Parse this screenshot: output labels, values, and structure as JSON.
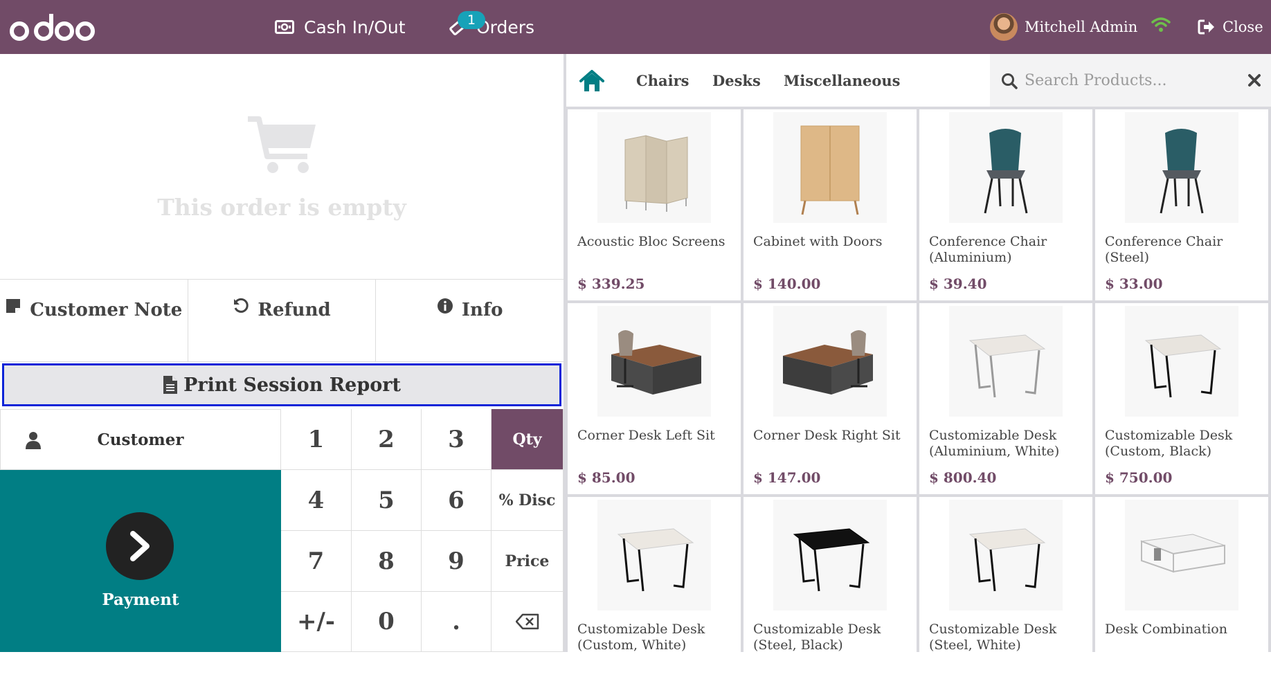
{
  "header": {
    "cash_label": "Cash In/Out",
    "orders_label": "Orders",
    "orders_badge": "1",
    "user_name": "Mitchell Admin",
    "close_label": "Close",
    "bg_color": "#714B67"
  },
  "order": {
    "empty_text": "This order is empty"
  },
  "controls": {
    "customer_note": "Customer Note",
    "refund": "Refund",
    "info": "Info",
    "print_session_report": "Print Session Report",
    "customer": "Customer",
    "payment": "Payment"
  },
  "numpad": {
    "keys": [
      "1",
      "2",
      "3",
      "Qty",
      "4",
      "5",
      "6",
      "% Disc",
      "7",
      "8",
      "9",
      "Price",
      "+/-",
      "0",
      "."
    ],
    "active_mode": "Qty"
  },
  "categories": {
    "items": [
      "Chairs",
      "Desks",
      "Miscellaneous"
    ]
  },
  "search": {
    "placeholder": "Search Products..."
  },
  "products": [
    {
      "name": "Acoustic Bloc Screens",
      "price": "$ 339.25",
      "icon": "screen-panels"
    },
    {
      "name": "Cabinet with Doors",
      "price": "$ 140.00",
      "icon": "cabinet"
    },
    {
      "name": "Conference Chair (Aluminium)",
      "price": "$ 39.40",
      "icon": "chair"
    },
    {
      "name": "Conference Chair (Steel)",
      "price": "$ 33.00",
      "icon": "chair"
    },
    {
      "name": "Corner Desk Left Sit",
      "price": "$ 85.00",
      "icon": "office-desk"
    },
    {
      "name": "Corner Desk Right Sit",
      "price": "$ 147.00",
      "icon": "office-desk"
    },
    {
      "name": "Customizable Desk (Aluminium, White)",
      "price": "$ 800.40",
      "icon": "table-white"
    },
    {
      "name": "Customizable Desk (Custom, Black)",
      "price": "$ 750.00",
      "icon": "table-white-black-legs"
    },
    {
      "name": "Customizable Desk (Custom, White)",
      "price": "",
      "icon": "table-white-black-legs"
    },
    {
      "name": "Customizable Desk (Steel, Black)",
      "price": "",
      "icon": "table-black"
    },
    {
      "name": "Customizable Desk (Steel, White)",
      "price": "",
      "icon": "table-white-black-legs"
    },
    {
      "name": "Desk Combination",
      "price": "",
      "icon": "desk-combination"
    }
  ],
  "colors": {
    "primary": "#714B67",
    "payment": "#017E84",
    "highlight_border": "#0b24d8",
    "home_icon": "#017E84"
  }
}
